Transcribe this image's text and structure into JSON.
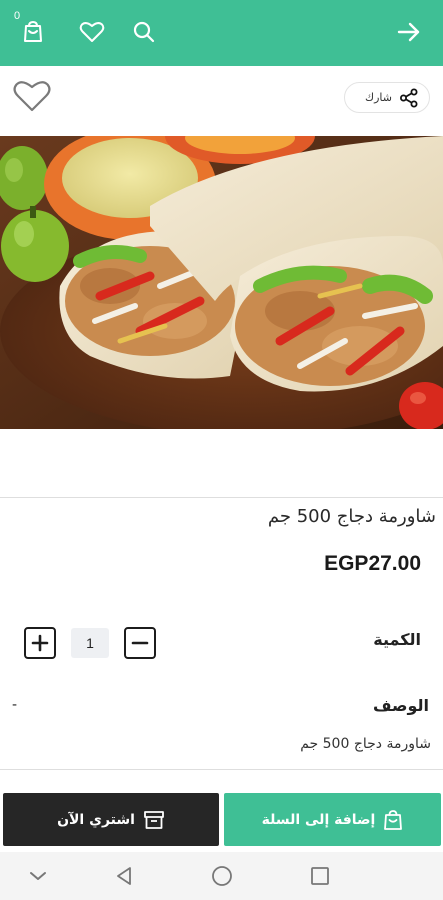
{
  "header": {
    "cart_count": "0",
    "icons": [
      "cart-icon",
      "heart-icon",
      "search-icon",
      "arrow-right-icon"
    ],
    "color": "#3fbf95"
  },
  "actions": {
    "share_label": "شارك"
  },
  "product": {
    "title": "شاورمة دجاج 500 جم",
    "price": "EGP27.00",
    "quantity_label": "الكمية",
    "quantity": "1",
    "description_label": "الوصف",
    "description_dash": "-",
    "description": "شاورمة دجاج 500 جم"
  },
  "buttons": {
    "add_to_cart": "إضافة إلى السلة",
    "buy_now": "اشتري الآن"
  },
  "colors": {
    "accent": "#3fbf95",
    "dark": "#262626"
  }
}
